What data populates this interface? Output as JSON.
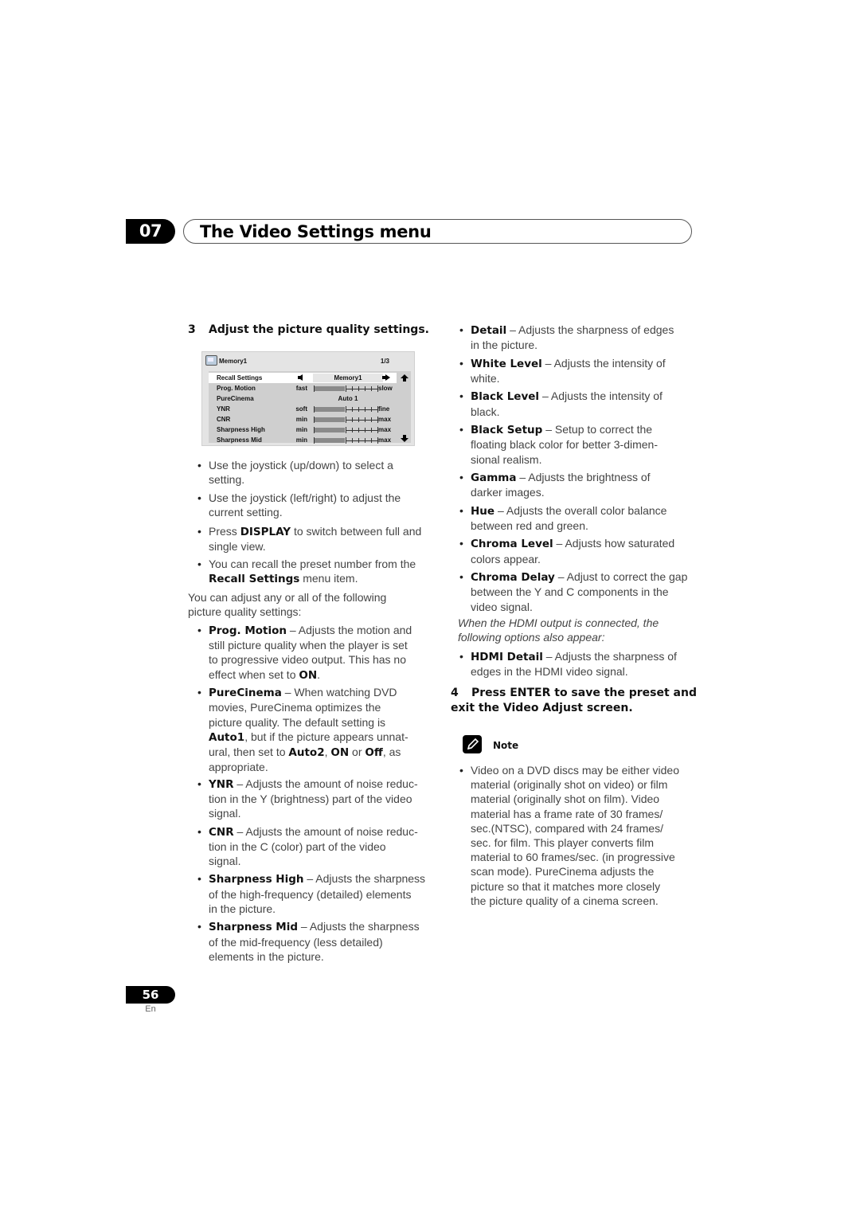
{
  "chapter": {
    "number": "07",
    "title": "The Video Settings menu"
  },
  "step3": {
    "number": "3",
    "text": "Adjust the picture quality settings."
  },
  "osd": {
    "icon": "disc-memory-icon",
    "title": "Memory1",
    "page": "1/3",
    "rows": [
      {
        "label": "Recall Settings",
        "type": "select",
        "value": "Memory1",
        "selected": true
      },
      {
        "label": "Prog. Motion",
        "type": "slider",
        "min_label": "fast",
        "max_label": "slow",
        "level": 0.5
      },
      {
        "label": "PureCinema",
        "type": "text",
        "value": "Auto 1"
      },
      {
        "label": "YNR",
        "type": "slider",
        "min_label": "soft",
        "max_label": "fine",
        "level": 0.5
      },
      {
        "label": "CNR",
        "type": "slider",
        "min_label": "min",
        "max_label": "max",
        "level": 0.5
      },
      {
        "label": "Sharpness High",
        "type": "slider",
        "min_label": "min",
        "max_label": "max",
        "level": 0.5
      },
      {
        "label": "Sharpness Mid",
        "type": "slider",
        "min_label": "min",
        "max_label": "max",
        "level": 0.5
      }
    ]
  },
  "left_bullets": [
    {
      "pre": "Use the joystick (up/down) to select a",
      "line2": "setting."
    },
    {
      "pre": "Use the joystick (left/right) to adjust the",
      "line2": "current setting."
    },
    {
      "pre": "Press ",
      "bold": "DISPLAY",
      "post": " to switch between full and",
      "line2": "single view."
    },
    {
      "pre": "You can recall the preset number from the",
      "bold2": "Recall Settings",
      "line2": " menu item."
    }
  ],
  "intro": {
    "line1": "You can adjust any or all of the following",
    "line2": "picture quality settings:"
  },
  "left_settings": [
    {
      "name": "Prog. Motion",
      "lines": [
        " – Adjusts the motion and",
        "still picture quality when the player is set",
        "to progressive video output. This has no",
        "effect when set to "
      ],
      "tail_bold": "ON",
      "tail": "."
    },
    {
      "name": "PureCinema",
      "lines": [
        " – When watching DVD",
        "movies, PureCinema optimizes the",
        "picture quality. The default setting is"
      ],
      "extra": {
        "b1": "Auto1",
        "t1": ", but if the picture appears unnat-",
        "t2": "ural, then set to ",
        "b2": "Auto2",
        "t3": ", ",
        "b3": "ON",
        "t4": " or ",
        "b4": "Off",
        "t5": ", as",
        "t6": "appropriate."
      }
    },
    {
      "name": "YNR",
      "lines": [
        " – Adjusts the amount of noise reduc-",
        "tion in the Y (brightness) part of the video",
        "signal."
      ]
    },
    {
      "name": "CNR",
      "lines": [
        " – Adjusts the amount of noise reduc-",
        "tion in the C (color) part of the video",
        "signal."
      ]
    },
    {
      "name": "Sharpness High",
      "lines": [
        " – Adjusts the sharpness",
        "of the high-frequency (detailed) elements",
        "in the picture."
      ]
    },
    {
      "name": "Sharpness Mid",
      "lines": [
        " – Adjusts the sharpness",
        "of the mid-frequency (less detailed)",
        "elements in the picture."
      ]
    }
  ],
  "right_settings": [
    {
      "name": "Detail",
      "lines": [
        " – Adjusts the sharpness of edges",
        "in the picture."
      ]
    },
    {
      "name": "White Level",
      "lines": [
        " – Adjusts the intensity of",
        "white."
      ]
    },
    {
      "name": "Black Level",
      "lines": [
        " – Adjusts the intensity of",
        "black."
      ]
    },
    {
      "name": "Black Setup",
      "lines": [
        " – Setup to correct the",
        "floating black color for better 3-dimen-",
        "sional realism."
      ]
    },
    {
      "name": "Gamma",
      "lines": [
        " – Adjusts the brightness of",
        "darker images."
      ]
    },
    {
      "name": "Hue",
      "lines": [
        " – Adjusts the overall color balance",
        "between red and green."
      ]
    },
    {
      "name": "Chroma Level",
      "lines": [
        " – Adjusts how saturated",
        "colors appear."
      ]
    },
    {
      "name": "Chroma Delay",
      "lines": [
        " – Adjust to correct the gap",
        "between the Y and C components in the",
        "video signal."
      ]
    }
  ],
  "hdmi_note": {
    "line1": "When the HDMI output is connected, the",
    "line2": "following options also appear:"
  },
  "hdmi_settings": [
    {
      "name": "HDMI Detail",
      "lines": [
        " – Adjusts the sharpness of",
        "edges in the HDMI video signal."
      ]
    }
  ],
  "step4": {
    "number": "4",
    "line1": "Press ENTER to save the preset and",
    "line2": "exit the Video Adjust screen."
  },
  "note": {
    "icon": "pencil-note-icon",
    "label": "Note",
    "lines": [
      "Video on a DVD discs may be either video",
      "material (originally shot on video) or film",
      "material (originally shot on film). Video",
      "material has a frame rate of 30 frames/",
      "sec.(NTSC), compared with 24 frames/",
      "sec. for film. This player converts film",
      "material to 60 frames/sec. (in progressive",
      "scan mode). PureCinema adjusts the",
      "picture so that it matches more closely",
      "the picture quality of a cinema screen."
    ]
  },
  "footer": {
    "page": "56",
    "lang": "En"
  }
}
